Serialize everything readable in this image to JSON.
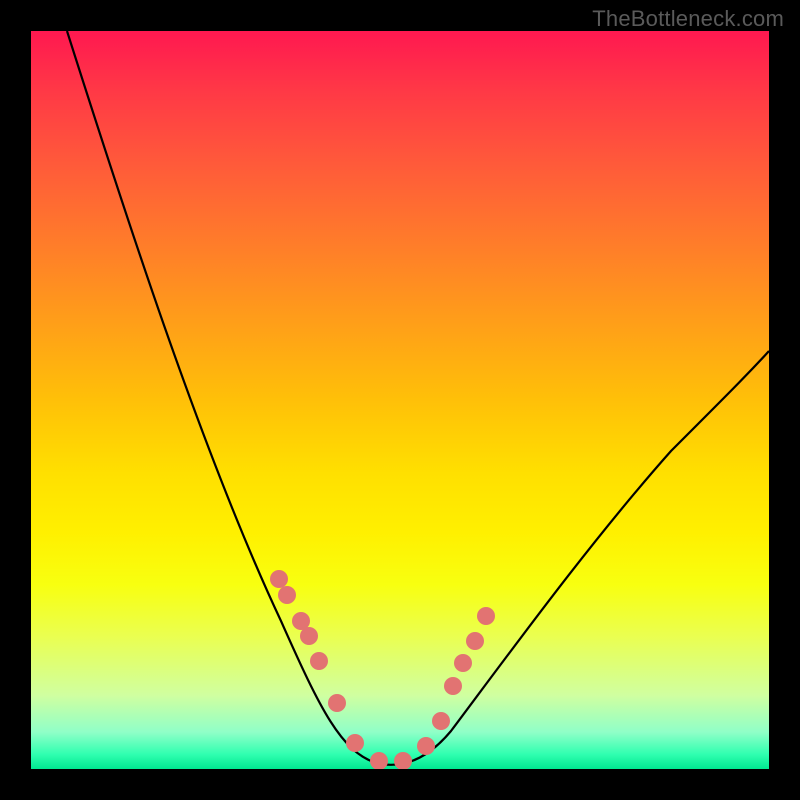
{
  "watermark": "TheBottleneck.com",
  "colors": {
    "dot": "#e27372",
    "curve": "#000000"
  },
  "chart_data": {
    "type": "line",
    "title": "",
    "xlabel": "",
    "ylabel": "",
    "xlim": [
      0,
      100
    ],
    "ylim": [
      0,
      100
    ],
    "note": "Axes have no visible tick labels; values are estimated proportional positions (0-100) from the plotted curve shape. Lower y = lower mismatch (better). The curve is a V/U shape with minimum near x≈47.",
    "series": [
      {
        "name": "bottleneck-curve",
        "x": [
          5,
          8,
          12,
          16,
          20,
          24,
          28,
          32,
          36,
          40,
          44,
          47,
          50,
          54,
          58,
          62,
          66,
          70,
          75,
          80,
          85,
          90,
          95,
          100
        ],
        "y": [
          100,
          92,
          82,
          72,
          62,
          53,
          44,
          36,
          28,
          20,
          10,
          2,
          2,
          4,
          10,
          17,
          23,
          29,
          35,
          41,
          46,
          50,
          54,
          57
        ]
      }
    ],
    "markers": {
      "name": "highlighted-points",
      "x": [
        33.5,
        34.5,
        36.5,
        37.5,
        39,
        41.5,
        44,
        47,
        50,
        53,
        55.5,
        57,
        58.5,
        60,
        61.5
      ],
      "y": [
        26,
        24,
        21,
        19,
        16,
        10,
        4,
        2,
        2,
        4,
        8,
        13,
        16,
        19,
        22
      ]
    }
  }
}
